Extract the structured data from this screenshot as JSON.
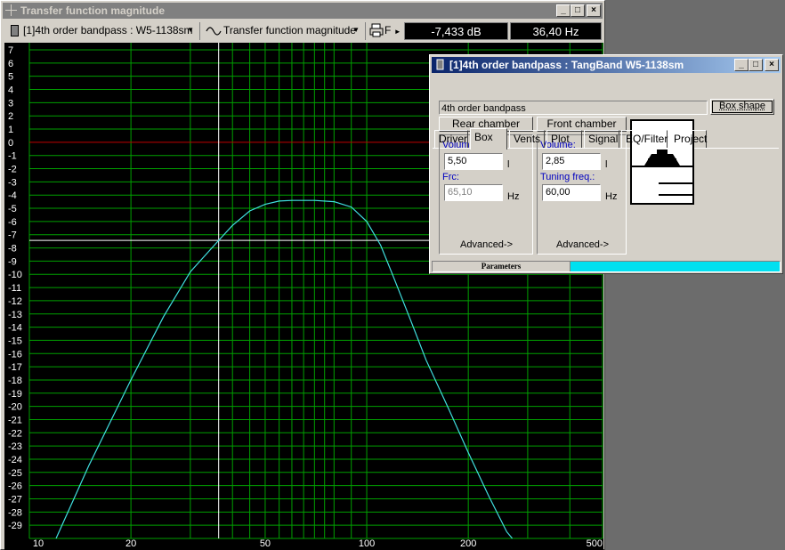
{
  "main_window": {
    "title": "Transfer function magnitude",
    "toolbar": {
      "project_combo": "[1]4th order bandpass : W5-1138sm",
      "plot_combo": "Transfer function magnitude",
      "print_label": "F",
      "readout_db": "-7,433 dB",
      "readout_hz": "36,40 Hz"
    }
  },
  "chart_data": {
    "type": "line",
    "x_scale": "log",
    "xlim": [
      10,
      500
    ],
    "ylim": [
      -30,
      7
    ],
    "x_ticks": [
      "10",
      "20",
      "50",
      "100",
      "200",
      "500"
    ],
    "y_ticks": [
      "7",
      "6",
      "5",
      "4",
      "3",
      "2",
      "1",
      "0",
      "-1",
      "-2",
      "-3",
      "-4",
      "-5",
      "-6",
      "-7",
      "-8",
      "-9",
      "-10",
      "-11",
      "-12",
      "-13",
      "-14",
      "-15",
      "-16",
      "-17",
      "-18",
      "-19",
      "-20",
      "-21",
      "-22",
      "-23",
      "-24",
      "-25",
      "-26",
      "-27",
      "-28",
      "-29"
    ],
    "grid": true,
    "reference_line_y": 0,
    "cursor": {
      "x": 36.4,
      "y": -7.433
    },
    "colors": {
      "background": "#000000",
      "grid": "#00a000",
      "curve": "#40e0e0",
      "zero_line": "#c00000",
      "cursor": "#ffffff",
      "axis_text": "#ffffff"
    },
    "series": [
      {
        "points": [
          [
            12,
            -30
          ],
          [
            15,
            -24.5
          ],
          [
            20,
            -18
          ],
          [
            25,
            -13.2
          ],
          [
            30,
            -9.8
          ],
          [
            36.4,
            -7.43
          ],
          [
            40,
            -6.3
          ],
          [
            45,
            -5.2
          ],
          [
            50,
            -4.7
          ],
          [
            55,
            -4.45
          ],
          [
            60,
            -4.4
          ],
          [
            70,
            -4.4
          ],
          [
            80,
            -4.5
          ],
          [
            90,
            -4.9
          ],
          [
            100,
            -6.0
          ],
          [
            110,
            -7.8
          ],
          [
            120,
            -10.2
          ],
          [
            135,
            -13.5
          ],
          [
            150,
            -16.5
          ],
          [
            175,
            -20.2
          ],
          [
            200,
            -23.5
          ],
          [
            230,
            -26.8
          ],
          [
            260,
            -29.5
          ],
          [
            270,
            -30
          ]
        ]
      }
    ]
  },
  "box_window": {
    "title": "[1]4th order bandpass : TangBand W5-1138sm",
    "tabs": [
      "Driver",
      "Box",
      "Vents",
      "Plot",
      "Signal",
      "EQ/Filter",
      "Project"
    ],
    "selected_tab": "Box",
    "box_type": "4th order bandpass",
    "box_shape_button": "Box shape",
    "rear": {
      "header": "Rear chamber",
      "volume_label": "Volume:",
      "volume_value": "5,50",
      "volume_unit": "l",
      "frc_label": "Frc:",
      "frc_value": "65,10",
      "frc_unit": "Hz",
      "advanced": "Advanced->"
    },
    "front": {
      "header": "Front chamber",
      "volume_label": "Volume:",
      "volume_value": "2,85",
      "volume_unit": "l",
      "tuning_label": "Tuning freq.:",
      "tuning_value": "60,00",
      "tuning_unit": "Hz",
      "advanced": "Advanced->"
    },
    "status_label": "Parameters",
    "status_progress": 0.0
  }
}
